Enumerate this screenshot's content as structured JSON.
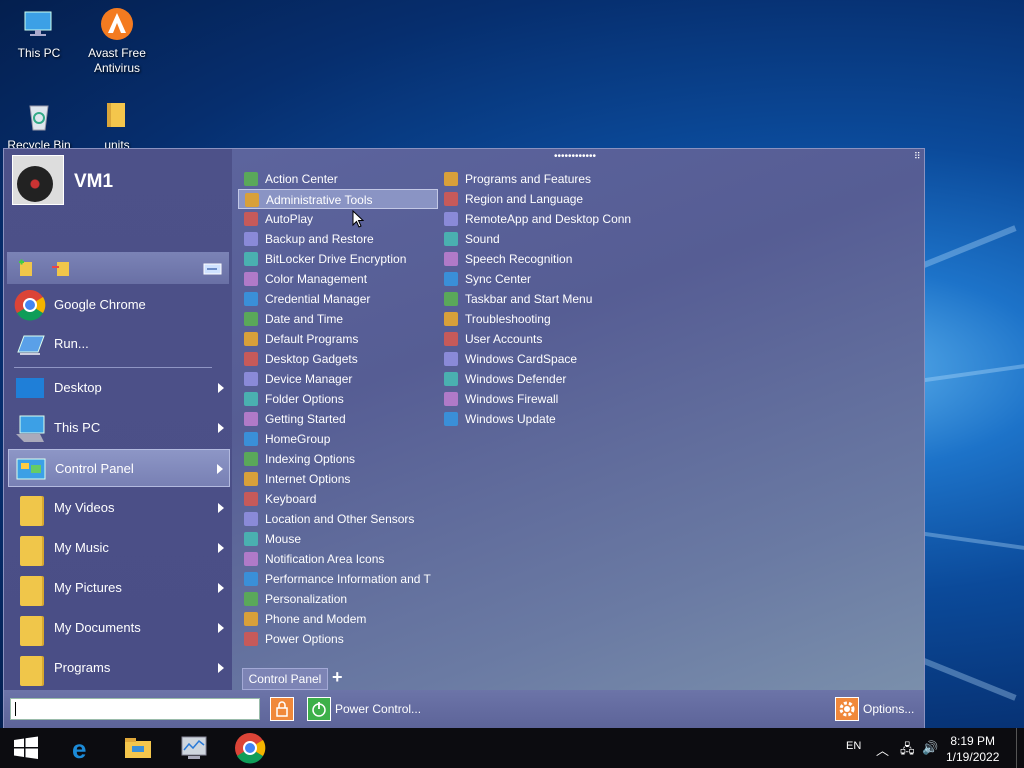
{
  "desktop": {
    "icons": [
      {
        "label": "This PC",
        "icon": "this-pc-icon"
      },
      {
        "label": "Avast Free Antivirus",
        "icon": "avast-icon"
      },
      {
        "label": "Recycle Bin",
        "icon": "recycle-bin-icon"
      },
      {
        "label": "units",
        "icon": "folder-icon"
      }
    ]
  },
  "start_menu": {
    "user_name": "VM1",
    "left_items": [
      {
        "label": "Google Chrome",
        "icon": "chrome-icon",
        "submenu": false
      },
      {
        "label": "Run...",
        "icon": "run-icon",
        "submenu": false
      },
      {
        "label": "Desktop",
        "icon": "desktop-icon",
        "submenu": true
      },
      {
        "label": "This PC",
        "icon": "this-pc-icon",
        "submenu": true
      },
      {
        "label": "Control Panel",
        "icon": "control-panel-icon",
        "submenu": true
      },
      {
        "label": "My Videos",
        "icon": "videos-folder-icon",
        "submenu": true
      },
      {
        "label": "My Music",
        "icon": "music-folder-icon",
        "submenu": true
      },
      {
        "label": "My Pictures",
        "icon": "pictures-folder-icon",
        "submenu": true
      },
      {
        "label": "My Documents",
        "icon": "documents-folder-icon",
        "submenu": true
      },
      {
        "label": "Programs",
        "icon": "programs-folder-icon",
        "submenu": true
      }
    ],
    "control_panel_col1": [
      "Action Center",
      "Administrative Tools",
      "AutoPlay",
      "Backup and Restore",
      "BitLocker Drive Encryption",
      "Color Management",
      "Credential Manager",
      "Date and Time",
      "Default Programs",
      "Desktop Gadgets",
      "Device Manager",
      "Folder Options",
      "Getting Started",
      "HomeGroup",
      "Indexing Options",
      "Internet Options",
      "Keyboard",
      "Location and Other Sensors",
      "Mouse",
      "Notification Area Icons",
      "Performance Information and T",
      "Personalization",
      "Phone and Modem",
      "Power Options"
    ],
    "control_panel_col2": [
      "Programs and Features",
      "Region and Language",
      "RemoteApp and Desktop Conn",
      "Sound",
      "Speech Recognition",
      "Sync Center",
      "Taskbar and Start Menu",
      "Troubleshooting",
      "User Accounts",
      "Windows CardSpace",
      "Windows Defender",
      "Windows Firewall",
      "Windows Update"
    ],
    "control_panel_tab": "Control Panel",
    "add_tab": "+",
    "power_label": "Power Control...",
    "options_label": "Options...",
    "search_value": ""
  },
  "taskbar": {
    "lang": "EN",
    "time": "8:19 PM",
    "date": "1/19/2022",
    "pinned": [
      "windows-start-icon",
      "edge-icon",
      "file-explorer-icon",
      "task-manager-icon",
      "chrome-icon"
    ]
  },
  "colors": {
    "menu_bg": "#5e66a0",
    "highlight": "#8a94c4",
    "taskbar": "#0c0c10"
  }
}
